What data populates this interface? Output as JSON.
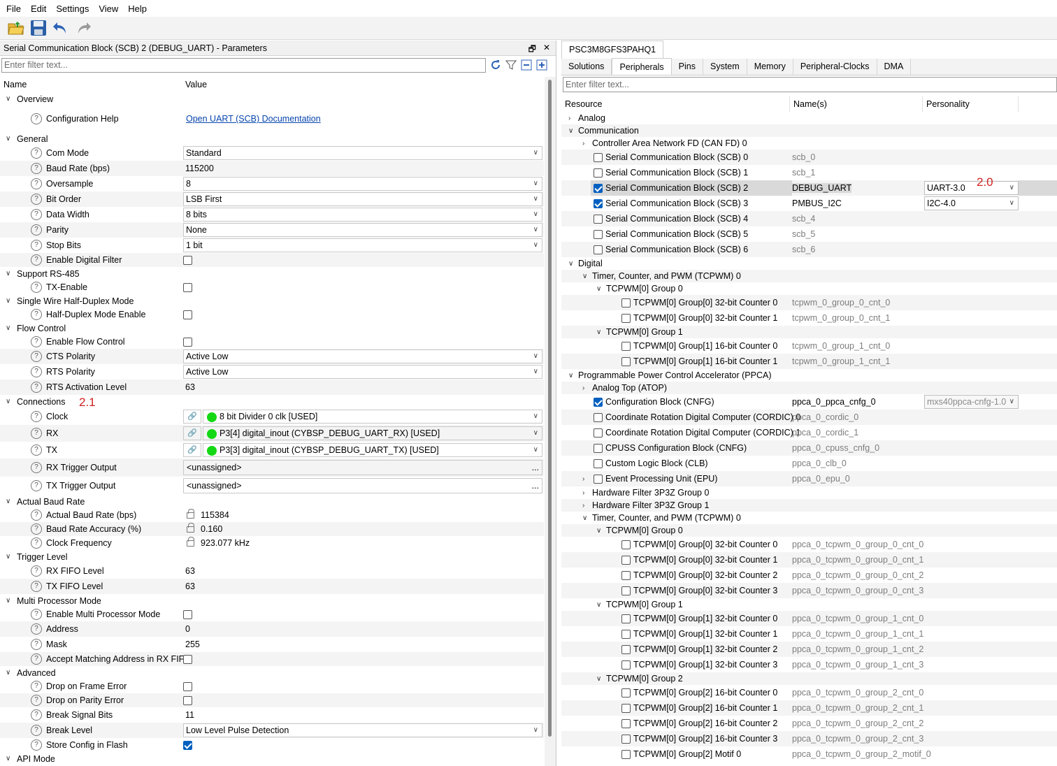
{
  "menu": [
    "File",
    "Edit",
    "Settings",
    "View",
    "Help"
  ],
  "left_panel": {
    "title": "Serial Communication Block (SCB) 2 (DEBUG_UART) - Parameters",
    "filter_placeholder": "Enter filter text...",
    "col_name": "Name",
    "col_value": "Value",
    "rows": [
      {
        "type": "group",
        "label": "Overview"
      },
      {
        "type": "link",
        "label": "Configuration Help",
        "value": "Open UART (SCB) Documentation"
      },
      {
        "type": "group",
        "label": "General"
      },
      {
        "type": "dropdown",
        "label": "Com Mode",
        "value": "Standard"
      },
      {
        "type": "text",
        "label": "Baud Rate (bps)",
        "value": "115200"
      },
      {
        "type": "dropdown",
        "label": "Oversample",
        "value": "8"
      },
      {
        "type": "dropdown",
        "label": "Bit Order",
        "value": "LSB First"
      },
      {
        "type": "dropdown",
        "label": "Data Width",
        "value": "8 bits"
      },
      {
        "type": "dropdown",
        "label": "Parity",
        "value": "None"
      },
      {
        "type": "dropdown",
        "label": "Stop Bits",
        "value": "1 bit"
      },
      {
        "type": "checkbox",
        "label": "Enable Digital Filter",
        "value": false
      },
      {
        "type": "group",
        "label": "Support RS-485"
      },
      {
        "type": "checkbox",
        "label": "TX-Enable",
        "value": false
      },
      {
        "type": "group",
        "label": "Single Wire Half-Duplex Mode"
      },
      {
        "type": "checkbox",
        "label": "Half-Duplex Mode Enable",
        "value": false
      },
      {
        "type": "group",
        "label": "Flow Control"
      },
      {
        "type": "checkbox",
        "label": "Enable Flow Control",
        "value": false
      },
      {
        "type": "dropdown",
        "label": "CTS Polarity",
        "value": "Active Low"
      },
      {
        "type": "dropdown",
        "label": "RTS Polarity",
        "value": "Active Low"
      },
      {
        "type": "text",
        "label": "RTS Activation Level",
        "value": "63"
      },
      {
        "type": "group",
        "label": "Connections"
      },
      {
        "type": "conn",
        "label": "Clock",
        "value": "8 bit Divider 0 clk [USED]"
      },
      {
        "type": "conn",
        "label": "RX",
        "value": "P3[4] digital_inout (CYBSP_DEBUG_UART_RX) [USED]"
      },
      {
        "type": "conn",
        "label": "TX",
        "value": "P3[3] digital_inout (CYBSP_DEBUG_UART_TX) [USED]"
      },
      {
        "type": "dots",
        "label": "RX Trigger Output",
        "value": "<unassigned>"
      },
      {
        "type": "dots",
        "label": "TX Trigger Output",
        "value": "<unassigned>"
      },
      {
        "type": "group",
        "label": "Actual Baud Rate"
      },
      {
        "type": "locked",
        "label": "Actual Baud Rate (bps)",
        "value": "115384"
      },
      {
        "type": "locked",
        "label": "Baud Rate Accuracy (%)",
        "value": "0.160"
      },
      {
        "type": "locked",
        "label": "Clock Frequency",
        "value": "923.077 kHz"
      },
      {
        "type": "group",
        "label": "Trigger Level"
      },
      {
        "type": "text",
        "label": "RX FIFO Level",
        "value": "63"
      },
      {
        "type": "text",
        "label": "TX FIFO Level",
        "value": "63"
      },
      {
        "type": "group",
        "label": "Multi Processor Mode"
      },
      {
        "type": "checkbox",
        "label": "Enable Multi Processor Mode",
        "value": false
      },
      {
        "type": "text",
        "label": "Address",
        "value": "0"
      },
      {
        "type": "text",
        "label": "Mask",
        "value": "255"
      },
      {
        "type": "checkbox",
        "label": "Accept Matching Address in RX FIFO",
        "value": false
      },
      {
        "type": "group",
        "label": "Advanced"
      },
      {
        "type": "checkbox",
        "label": "Drop on Frame Error",
        "value": false
      },
      {
        "type": "checkbox",
        "label": "Drop on Parity Error",
        "value": false
      },
      {
        "type": "text",
        "label": "Break Signal Bits",
        "value": "11"
      },
      {
        "type": "dropdown",
        "label": "Break Level",
        "value": "Low Level Pulse Detection"
      },
      {
        "type": "checkbox",
        "label": "Store Config in Flash",
        "value": true
      },
      {
        "type": "group",
        "label": "API Mode"
      }
    ],
    "annotation": "2.1"
  },
  "right_panel": {
    "device_tab": "PSC3M8GFS3PAHQ1",
    "tabs": [
      "Solutions",
      "Peripherals",
      "Pins",
      "System",
      "Memory",
      "Peripheral-Clocks",
      "DMA"
    ],
    "selected_tab": "Peripherals",
    "filter_placeholder": "Enter filter text...",
    "col_resource": "Resource",
    "col_names": "Name(s)",
    "col_personality": "Personality",
    "annotation": "2.0",
    "rows": [
      {
        "lvl": 0,
        "chev": ">",
        "label": "Analog"
      },
      {
        "lvl": 0,
        "chev": "v",
        "label": "Communication"
      },
      {
        "lvl": 1,
        "chev": ">",
        "label": "Controller Area Network FD (CAN FD) 0"
      },
      {
        "lvl": 1,
        "cb": false,
        "label": "Serial Communication Block (SCB) 0",
        "name": "scb_0"
      },
      {
        "lvl": 1,
        "cb": false,
        "label": "Serial Communication Block (SCB) 1",
        "name": "scb_1"
      },
      {
        "lvl": 1,
        "cb": true,
        "label": "Serial Communication Block (SCB) 2",
        "name": "DEBUG_UART",
        "pers": "UART-3.0",
        "sel": true
      },
      {
        "lvl": 1,
        "cb": true,
        "label": "Serial Communication Block (SCB) 3",
        "name": "PMBUS_I2C",
        "pers": "I2C-4.0"
      },
      {
        "lvl": 1,
        "cb": false,
        "label": "Serial Communication Block (SCB) 4",
        "name": "scb_4"
      },
      {
        "lvl": 1,
        "cb": false,
        "label": "Serial Communication Block (SCB) 5",
        "name": "scb_5"
      },
      {
        "lvl": 1,
        "cb": false,
        "label": "Serial Communication Block (SCB) 6",
        "name": "scb_6"
      },
      {
        "lvl": 0,
        "chev": "v",
        "label": "Digital"
      },
      {
        "lvl": 1,
        "chev": "v",
        "label": "Timer, Counter, and PWM (TCPWM) 0"
      },
      {
        "lvl": 2,
        "chev": "v",
        "label": "TCPWM[0] Group 0"
      },
      {
        "lvl": 3,
        "cb": false,
        "label": "TCPWM[0] Group[0] 32-bit Counter 0",
        "name": "tcpwm_0_group_0_cnt_0"
      },
      {
        "lvl": 3,
        "cb": false,
        "label": "TCPWM[0] Group[0] 32-bit Counter 1",
        "name": "tcpwm_0_group_0_cnt_1"
      },
      {
        "lvl": 2,
        "chev": "v",
        "label": "TCPWM[0] Group 1"
      },
      {
        "lvl": 3,
        "cb": false,
        "label": "TCPWM[0] Group[1] 16-bit Counter 0",
        "name": "tcpwm_0_group_1_cnt_0"
      },
      {
        "lvl": 3,
        "cb": false,
        "label": "TCPWM[0] Group[1] 16-bit Counter 1",
        "name": "tcpwm_0_group_1_cnt_1"
      },
      {
        "lvl": 0,
        "chev": "v",
        "label": "Programmable Power Control Accelerator (PPCA)"
      },
      {
        "lvl": 1,
        "chev": ">",
        "label": "Analog Top (ATOP)"
      },
      {
        "lvl": 1,
        "cb": true,
        "label": "Configuration Block (CNFG)",
        "name": "ppca_0_ppca_cnfg_0",
        "pers": "mxs40ppca-cnfg-1.0",
        "persDis": true
      },
      {
        "lvl": 1,
        "cb": false,
        "label": "Coordinate Rotation Digital Computer (CORDIC) 0",
        "name": "ppca_0_cordic_0"
      },
      {
        "lvl": 1,
        "cb": false,
        "label": "Coordinate Rotation Digital Computer (CORDIC) 1",
        "name": "ppca_0_cordic_1"
      },
      {
        "lvl": 1,
        "cb": false,
        "label": "CPUSS Configuration Block (CNFG)",
        "name": "ppca_0_cpuss_cnfg_0"
      },
      {
        "lvl": 1,
        "cb": false,
        "label": "Custom Logic Block (CLB)",
        "name": "ppca_0_clb_0"
      },
      {
        "lvl": 1,
        "chev": ">",
        "cb": false,
        "label": "Event Processing Unit (EPU)",
        "name": "ppca_0_epu_0"
      },
      {
        "lvl": 1,
        "chev": ">",
        "label": "Hardware Filter 3P3Z Group 0"
      },
      {
        "lvl": 1,
        "chev": ">",
        "label": "Hardware Filter 3P3Z Group 1"
      },
      {
        "lvl": 1,
        "chev": "v",
        "label": "Timer, Counter, and PWM (TCPWM) 0"
      },
      {
        "lvl": 2,
        "chev": "v",
        "label": "TCPWM[0] Group 0"
      },
      {
        "lvl": 3,
        "cb": false,
        "label": "TCPWM[0] Group[0] 32-bit Counter 0",
        "name": "ppca_0_tcpwm_0_group_0_cnt_0"
      },
      {
        "lvl": 3,
        "cb": false,
        "label": "TCPWM[0] Group[0] 32-bit Counter 1",
        "name": "ppca_0_tcpwm_0_group_0_cnt_1"
      },
      {
        "lvl": 3,
        "cb": false,
        "label": "TCPWM[0] Group[0] 32-bit Counter 2",
        "name": "ppca_0_tcpwm_0_group_0_cnt_2"
      },
      {
        "lvl": 3,
        "cb": false,
        "label": "TCPWM[0] Group[0] 32-bit Counter 3",
        "name": "ppca_0_tcpwm_0_group_0_cnt_3"
      },
      {
        "lvl": 2,
        "chev": "v",
        "label": "TCPWM[0] Group 1"
      },
      {
        "lvl": 3,
        "cb": false,
        "label": "TCPWM[0] Group[1] 32-bit Counter 0",
        "name": "ppca_0_tcpwm_0_group_1_cnt_0"
      },
      {
        "lvl": 3,
        "cb": false,
        "label": "TCPWM[0] Group[1] 32-bit Counter 1",
        "name": "ppca_0_tcpwm_0_group_1_cnt_1"
      },
      {
        "lvl": 3,
        "cb": false,
        "label": "TCPWM[0] Group[1] 32-bit Counter 2",
        "name": "ppca_0_tcpwm_0_group_1_cnt_2"
      },
      {
        "lvl": 3,
        "cb": false,
        "label": "TCPWM[0] Group[1] 32-bit Counter 3",
        "name": "ppca_0_tcpwm_0_group_1_cnt_3"
      },
      {
        "lvl": 2,
        "chev": "v",
        "label": "TCPWM[0] Group 2"
      },
      {
        "lvl": 3,
        "cb": false,
        "label": "TCPWM[0] Group[2] 16-bit Counter 0",
        "name": "ppca_0_tcpwm_0_group_2_cnt_0"
      },
      {
        "lvl": 3,
        "cb": false,
        "label": "TCPWM[0] Group[2] 16-bit Counter 1",
        "name": "ppca_0_tcpwm_0_group_2_cnt_1"
      },
      {
        "lvl": 3,
        "cb": false,
        "label": "TCPWM[0] Group[2] 16-bit Counter 2",
        "name": "ppca_0_tcpwm_0_group_2_cnt_2"
      },
      {
        "lvl": 3,
        "cb": false,
        "label": "TCPWM[0] Group[2] 16-bit Counter 3",
        "name": "ppca_0_tcpwm_0_group_2_cnt_3"
      },
      {
        "lvl": 3,
        "cb": false,
        "label": "TCPWM[0] Group[2] Motif 0",
        "name": "ppca_0_tcpwm_0_group_2_motif_0"
      }
    ]
  }
}
